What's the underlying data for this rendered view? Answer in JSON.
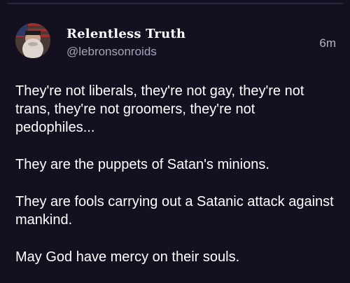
{
  "author": {
    "display_name": "Relentless Truth",
    "handle": "@lebronsonroids",
    "avatar_icon": "bearded-man-flag-avatar"
  },
  "post": {
    "timestamp": "6m",
    "paragraphs": [
      "They're not liberals, they're not gay, they're not trans, they're not groomers, they're not pedophiles...",
      "They are the puppets of Satan's minions.",
      "They are fools carrying out a Satanic attack against mankind.",
      "May God have mercy on their souls."
    ]
  },
  "colors": {
    "background": "#14101f",
    "primary_text": "#ffffff",
    "secondary_text": "#a6a2b8",
    "divider": "#2a2540"
  }
}
